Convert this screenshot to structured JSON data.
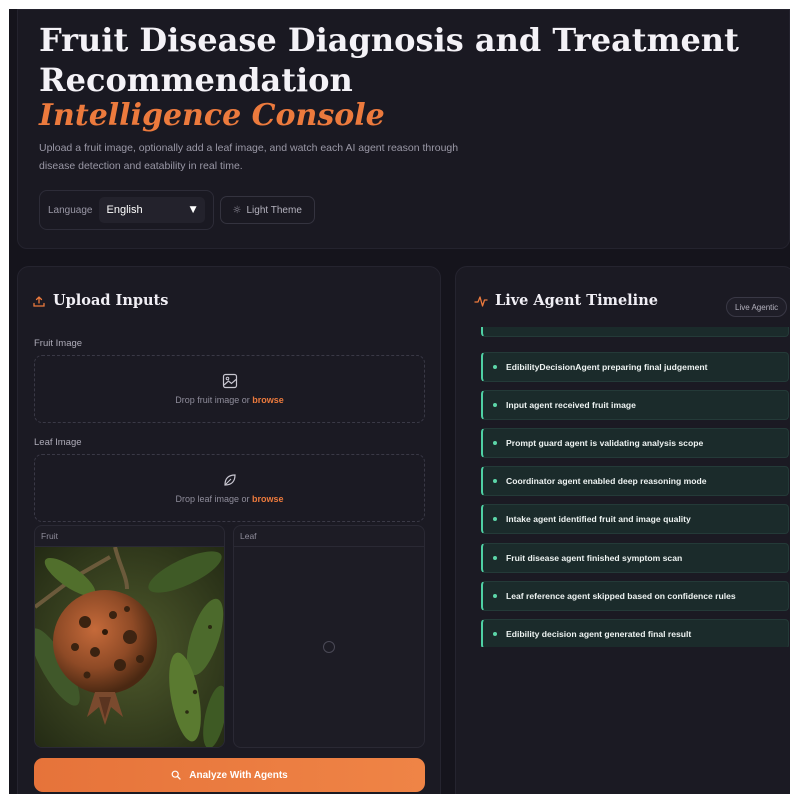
{
  "hero": {
    "title": "Fruit Disease Diagnosis and Treatment Recommendation",
    "accent": "Intelligence Console",
    "description": "Upload a fruit image, optionally add a leaf image, and watch each AI agent reason through disease detection and eatability in real time.",
    "language_label": "Language",
    "language_value": "English",
    "theme_button": "Light Theme"
  },
  "upload": {
    "title": "Upload Inputs",
    "fruit_label": "Fruit Image",
    "fruit_drop": "Drop fruit image or ",
    "leaf_label": "Leaf Image",
    "leaf_drop": "Drop leaf image or ",
    "browse": "browse",
    "preview_fruit": "Fruit",
    "preview_leaf": "Leaf",
    "analyze_button": "Analyze With Agents"
  },
  "timeline": {
    "title": "Live Agent Timeline",
    "badge": "Live Agentic",
    "items": [
      "EdibilityDecisionAgent preparing final judgement",
      "Input agent received fruit image",
      "Prompt guard agent is validating analysis scope",
      "Coordinator agent enabled deep reasoning mode",
      "Intake agent identified fruit and image quality",
      "Fruit disease agent finished symptom scan",
      "Leaf reference agent skipped based on confidence rules",
      "Edibility decision agent generated final result"
    ]
  },
  "colors": {
    "accent": "#ec7a3d",
    "timeline_accent": "#4fd1a4",
    "background": "#15141c"
  }
}
